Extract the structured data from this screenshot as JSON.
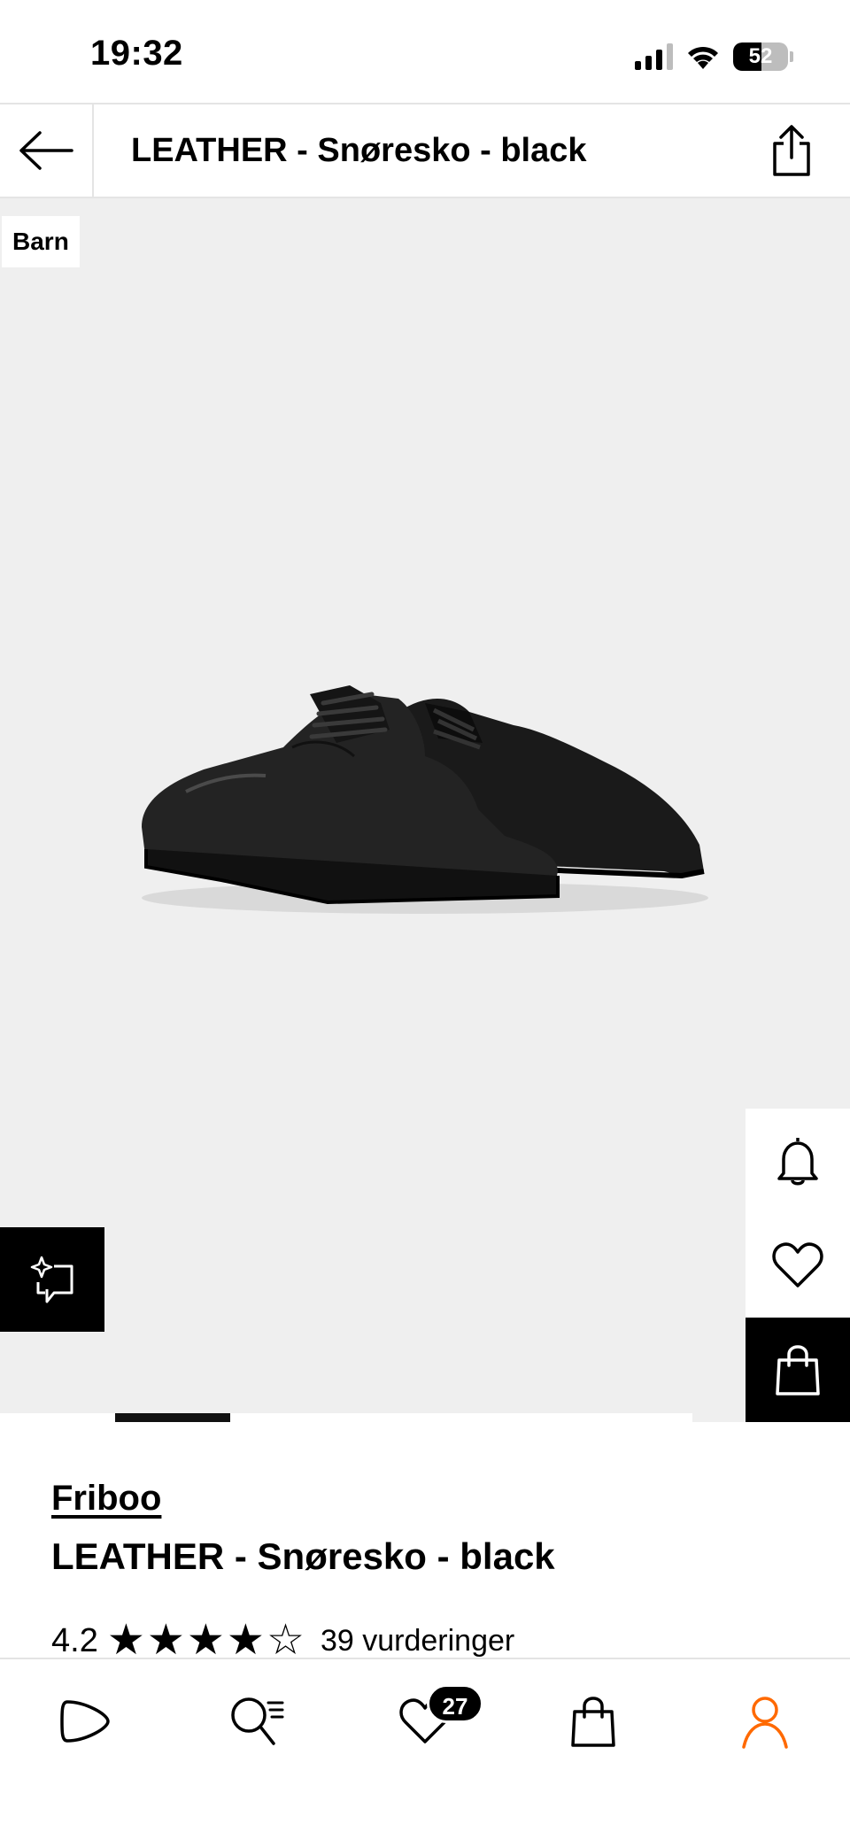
{
  "status_bar": {
    "time": "19:32",
    "battery_percent": "52",
    "battery_level": 0.52,
    "icons": [
      "signal-icon",
      "wifi-icon",
      "battery-icon"
    ]
  },
  "header": {
    "title": "LEATHER - Snøresko - black",
    "back_icon": "arrow-left-icon",
    "share_icon": "share-icon"
  },
  "product_image": {
    "tag": "Barn",
    "actions": [
      "bell-icon",
      "heart-icon",
      "shopping-bag-icon"
    ],
    "ai_icon": "sparkle-chat-icon"
  },
  "product": {
    "brand": "Friboo",
    "name": "LEATHER - Snøresko - black",
    "rating": "4.2",
    "stars_filled": 4,
    "stars_total": 5,
    "rating_count": "39 vurderinger"
  },
  "bottom_nav": {
    "items": [
      {
        "icon": "play-icon"
      },
      {
        "icon": "search-icon"
      },
      {
        "icon": "heart-icon",
        "badge": "27"
      },
      {
        "icon": "shopping-bag-icon"
      },
      {
        "icon": "profile-icon",
        "active": true
      }
    ],
    "active_color": "#ff6900"
  }
}
